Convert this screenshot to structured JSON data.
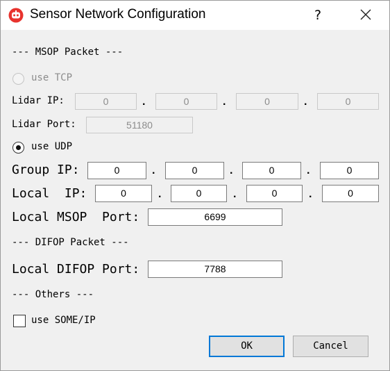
{
  "window": {
    "title": "Sensor Network Configuration",
    "help_glyph": "?",
    "close_glyph": "×"
  },
  "msop": {
    "section_label": "--- MSOP Packet ---",
    "tcp": {
      "radio_label": "use TCP",
      "selected": false,
      "enabled": false,
      "lidar_ip_label": "Lidar IP:",
      "lidar_ip": [
        "0",
        "0",
        "0",
        "0"
      ],
      "lidar_port_label": "Lidar Port:",
      "lidar_port": "51180"
    },
    "udp": {
      "radio_label": "use UDP",
      "selected": true,
      "group_ip_label": "Group IP:",
      "group_ip": [
        "0",
        "0",
        "0",
        "0"
      ],
      "local_ip_label": "Local  IP:",
      "local_ip": [
        "0",
        "0",
        "0",
        "0"
      ]
    },
    "local_port_label": "Local MSOP  Port:",
    "local_port": "6699"
  },
  "difop": {
    "section_label": "--- DIFOP Packet ---",
    "local_port_label": "Local DIFOP Port:",
    "local_port": "7788"
  },
  "others": {
    "section_label": "--- Others ---",
    "someip_label": "use SOME/IP",
    "someip_checked": false
  },
  "buttons": {
    "ok": "OK",
    "cancel": "Cancel"
  },
  "ip_separator": ".",
  "colors": {
    "accent": "#0078d7",
    "app_icon": "#e8332e",
    "disabled_text": "#8c8c8c"
  }
}
